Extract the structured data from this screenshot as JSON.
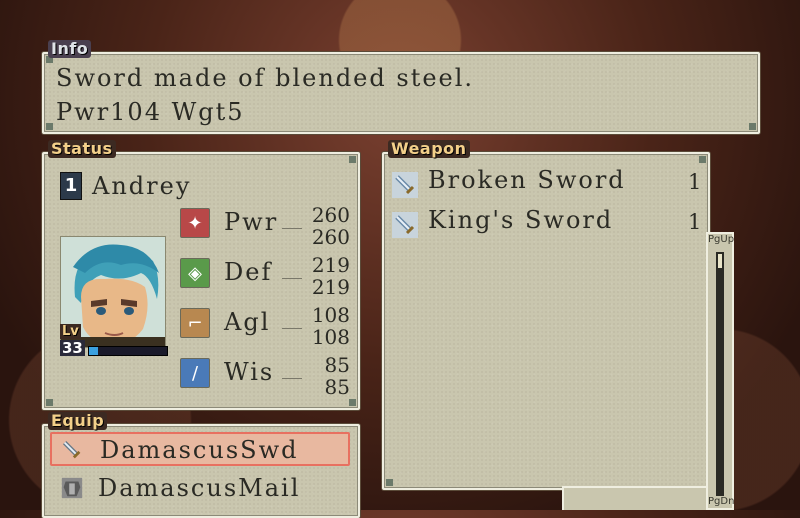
{
  "info": {
    "tag": "Info",
    "line1": "Sword made of blended steel.",
    "line2": "Pwr104 Wgt5"
  },
  "status": {
    "tag": "Status",
    "slot": "1",
    "name": "Andrey",
    "level_label": "Lv",
    "level": "33",
    "exp_fraction": 0.12,
    "stats": [
      {
        "label": "Pwr",
        "current": "260",
        "max": "260",
        "icon": "fist-icon"
      },
      {
        "label": "Def",
        "current": "219",
        "max": "219",
        "icon": "shield-icon"
      },
      {
        "label": "Agl",
        "current": "108",
        "max": "108",
        "icon": "boot-icon"
      },
      {
        "label": "Wis",
        "current": "85",
        "max": "85",
        "icon": "staff-icon"
      }
    ]
  },
  "weapon": {
    "tag": "Weapon",
    "items": [
      {
        "name": "Broken Sword",
        "qty": "1",
        "icon": "sword-icon"
      },
      {
        "name": "King's Sword",
        "qty": "1",
        "icon": "sword-icon"
      }
    ],
    "page_up": "PgUp",
    "page_down": "PgDn"
  },
  "equip": {
    "tag": "Equip",
    "items": [
      {
        "name": "DamascusSwd",
        "icon": "sword-icon",
        "selected": true
      },
      {
        "name": "DamascusMail",
        "icon": "armor-icon",
        "selected": false
      }
    ]
  },
  "colors": {
    "panel": "#c9c6ae",
    "text": "#2a2a24",
    "tag_gold": "#f3d08a",
    "selection": "#e8a090"
  }
}
